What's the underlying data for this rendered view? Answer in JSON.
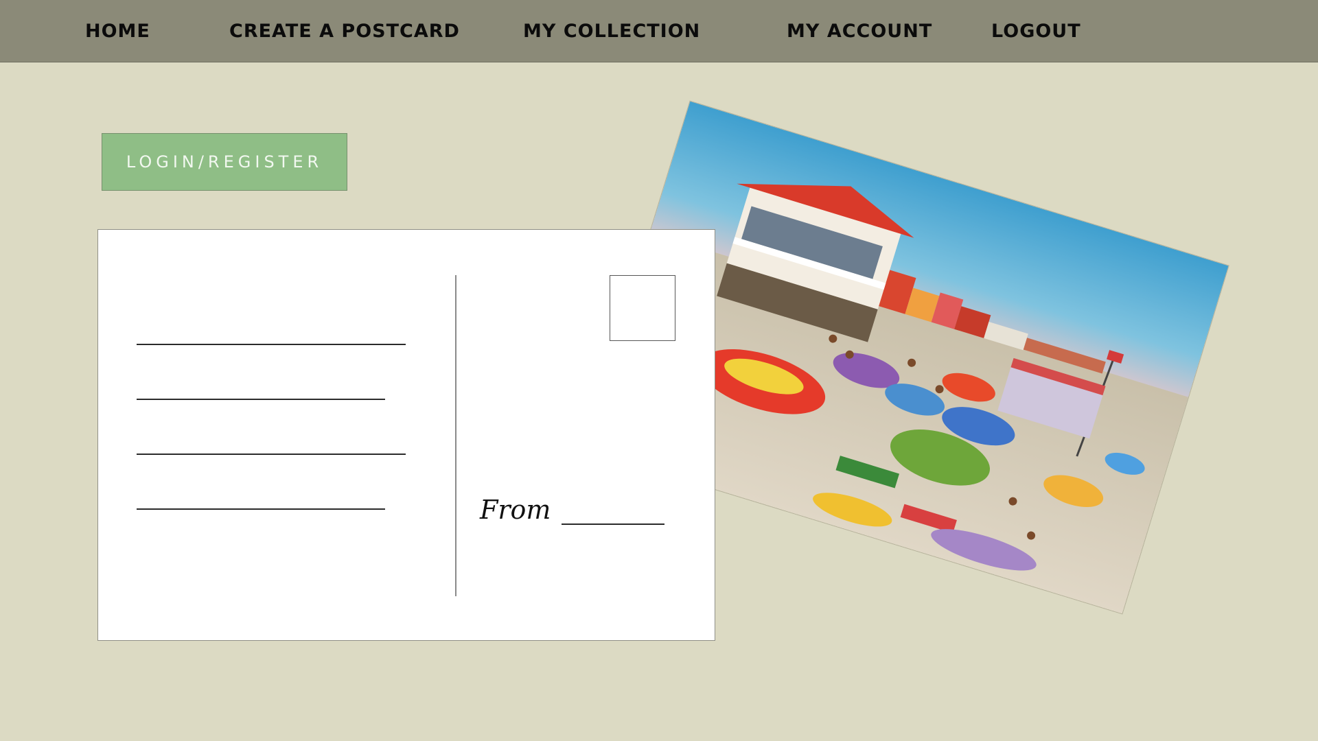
{
  "nav": {
    "home": "Home",
    "create": "Create a Postcard",
    "collection": "My Collection",
    "account": "My Account",
    "logout": "Logout"
  },
  "login_button": "LOGIN/REGISTER",
  "postcard": {
    "from_label": "From",
    "address_lines": 4
  },
  "picture": {
    "description_icon": "beach-boardwalk-illustration"
  },
  "colors": {
    "page_background": "#dcdac3",
    "nav_background": "#8b8a78",
    "button_background": "#8fbe86",
    "button_text": "#f2f8f0"
  }
}
